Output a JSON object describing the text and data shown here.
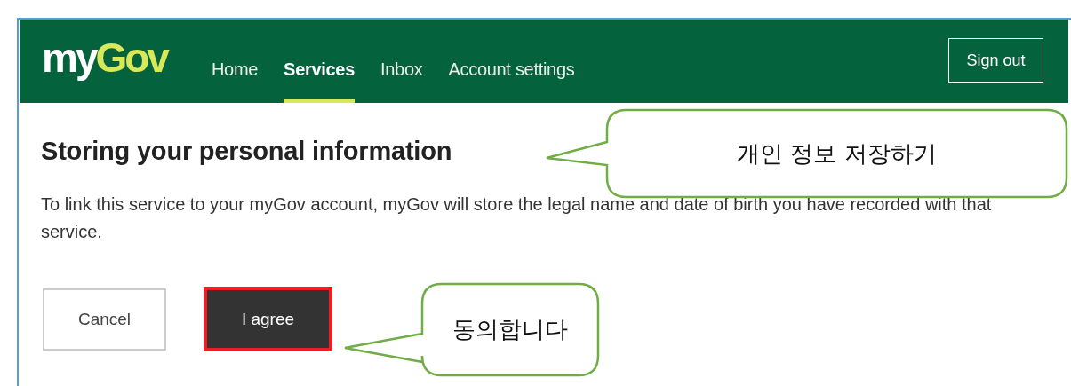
{
  "header": {
    "logo": [
      {
        "text": "my",
        "color": "#ffffff"
      },
      {
        "text": "Gov",
        "color": "#d7e85a"
      }
    ],
    "nav": [
      {
        "label": "Home",
        "selected": false
      },
      {
        "label": "Services",
        "selected": true
      },
      {
        "label": "Inbox",
        "selected": false
      },
      {
        "label": "Account settings",
        "selected": false
      }
    ],
    "sign_out": "Sign out"
  },
  "heading": "Storing your personal information",
  "body": "To link this service to your myGov account, myGov will store the legal name and date of birth you have recorded with that service.",
  "buttons": [
    {
      "label": "Cancel",
      "kind": "secondary",
      "highlighted": false
    },
    {
      "label": "I agree",
      "kind": "primary",
      "highlighted": true
    }
  ],
  "callouts": [
    {
      "text": "개인 정보 저장하기"
    },
    {
      "text": "동의합니다"
    }
  ]
}
